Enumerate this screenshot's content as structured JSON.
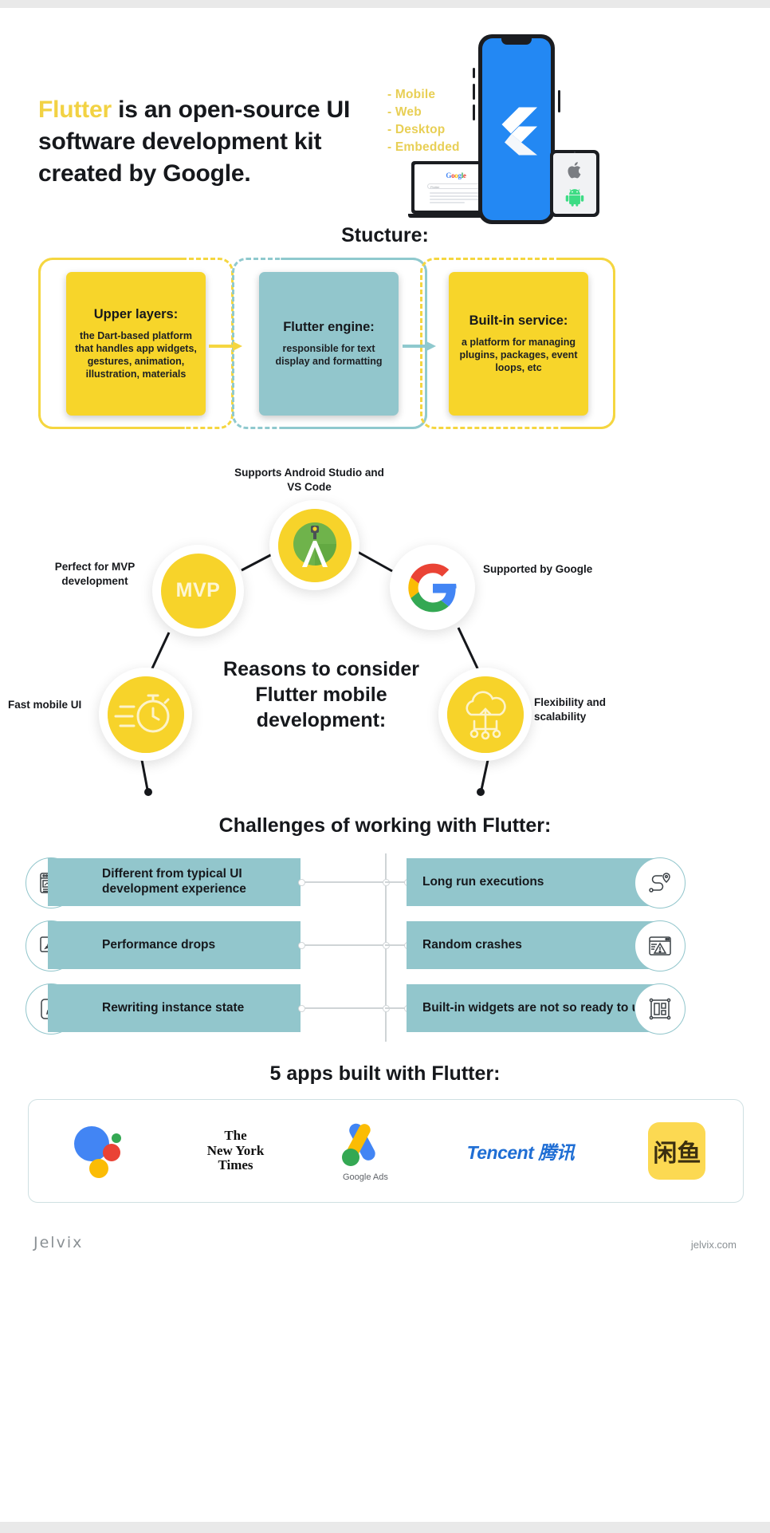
{
  "hero": {
    "title_highlight": "Flutter",
    "title_rest": " is an open-source UI software development kit created by Google.",
    "platforms": [
      "- Mobile",
      "- Web",
      "- Desktop",
      "- Embedded"
    ],
    "laptop_brand": "Google",
    "laptop_search_placeholder": "Flutter"
  },
  "structure": {
    "title": "Stucture:",
    "cards": [
      {
        "heading": "Upper layers:",
        "body": "the Dart-based platform that handles app widgets, gestures, animation, illustration, materials",
        "color": "#f7d52a"
      },
      {
        "heading": "Flutter engine:",
        "body": "responsible for text display and formatting",
        "color": "#92c6cc"
      },
      {
        "heading": "Built-in service:",
        "body": "a platform for managing plugins, packages, event loops, etc",
        "color": "#f7d52a"
      }
    ]
  },
  "reasons": {
    "center": "Reasons to consider Flutter mobile development:",
    "nodes": [
      {
        "icon": "android-studio-icon",
        "label": "Supports Android Studio and VS Code"
      },
      {
        "icon": "mvp-text-icon",
        "label": "Perfect for MVP development",
        "badge": "MVP"
      },
      {
        "icon": "google-logo-icon",
        "label": "Supported by Google"
      },
      {
        "icon": "stopwatch-icon",
        "label": "Fast mobile UI"
      },
      {
        "icon": "cloud-upload-icon",
        "label": "Flexibility and scalability"
      }
    ]
  },
  "challenges": {
    "title": "Challenges of working with Flutter:",
    "rows": [
      {
        "left": "Different from typical UI development experience",
        "left_icon": "browser-chart-icon",
        "right": "Long run executions",
        "right_icon": "route-pin-icon"
      },
      {
        "left": "Performance drops",
        "left_icon": "rocket-monitor-icon",
        "right": "Random crashes",
        "right_icon": "warning-window-icon"
      },
      {
        "left": "Rewriting instance state",
        "left_icon": "pencil-edit-icon",
        "right": "Built-in widgets are not so ready to use",
        "right_icon": "layout-frame-icon"
      }
    ]
  },
  "apps": {
    "title": "5 apps built with Flutter:",
    "items": [
      {
        "name": "Google Assistant",
        "icon": "google-assistant-icon",
        "caption": ""
      },
      {
        "name": "The New York Times",
        "icon": "nyt-icon",
        "caption": "The New York Times"
      },
      {
        "name": "Google Ads",
        "icon": "google-ads-icon",
        "caption": "Google Ads"
      },
      {
        "name": "Tencent",
        "icon": "tencent-icon",
        "caption": "Tencent 腾讯"
      },
      {
        "name": "Xianyu",
        "icon": "xianyu-icon",
        "caption": "闲鱼"
      }
    ]
  },
  "footer": {
    "brand": "Jelvix",
    "site": "jelvix.com"
  },
  "colors": {
    "yellow": "#f7d52a",
    "yellow_soft": "#f2d243",
    "teal": "#92c6cc",
    "blue": "#2388f3",
    "dark": "#16181c"
  }
}
